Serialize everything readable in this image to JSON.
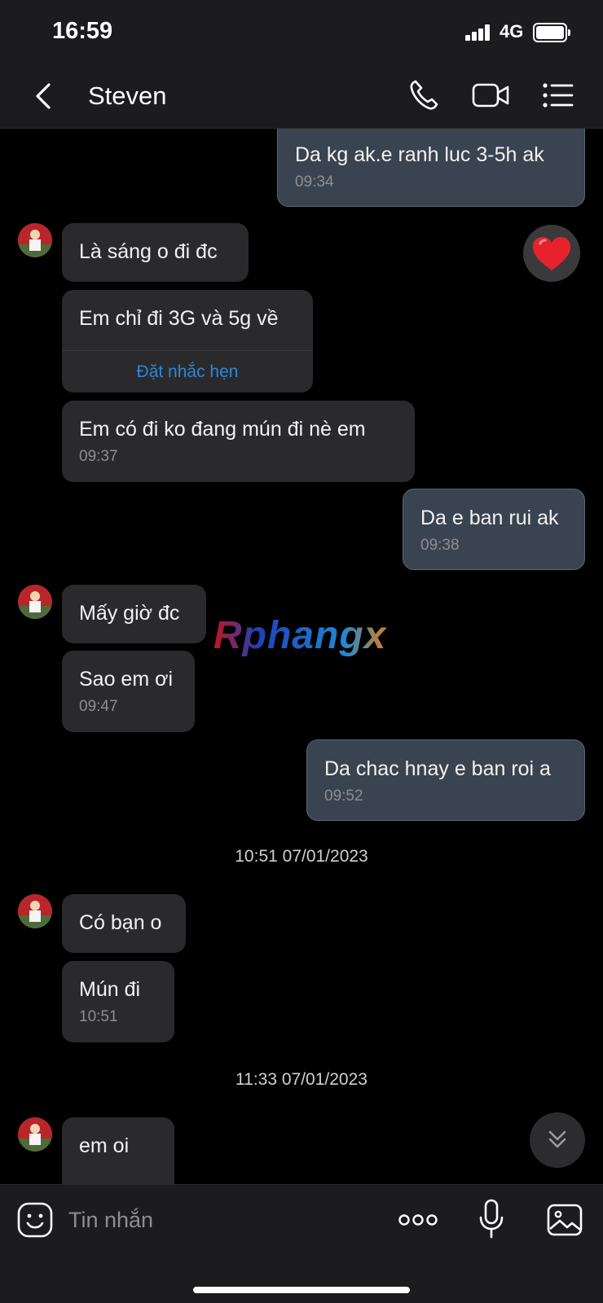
{
  "status_bar": {
    "time": "16:59",
    "network": "4G",
    "signal_icon": "signal-icon",
    "battery_icon": "battery-icon"
  },
  "header": {
    "back_icon": "chevron-left-icon",
    "title": "Steven",
    "call_icon": "phone-icon",
    "video_icon": "video-camera-icon",
    "menu_icon": "list-icon"
  },
  "messages": [
    {
      "id": "m1",
      "direction": "outgoing",
      "text": "Da kg ak.e ranh luc 3-5h ak",
      "time": "09:34"
    },
    {
      "id": "m2",
      "direction": "incoming",
      "text": "Là sáng o đi đc",
      "time": "",
      "reaction": "heart"
    },
    {
      "id": "m3",
      "direction": "incoming",
      "text": "Em chỉ đi 3G và 5g về",
      "time": "",
      "action": "Đặt nhắc hẹn"
    },
    {
      "id": "m4",
      "direction": "incoming",
      "text": "Em có đi ko đang mún đi nè em",
      "time": "09:37"
    },
    {
      "id": "m5",
      "direction": "outgoing",
      "text": "Da e ban rui ak",
      "time": "09:38"
    },
    {
      "id": "m6",
      "direction": "incoming",
      "text": "Mấy giờ đc",
      "time": ""
    },
    {
      "id": "m7",
      "direction": "incoming",
      "text": "Sao em ơi",
      "time": "09:47"
    },
    {
      "id": "m8",
      "direction": "outgoing",
      "text": "Da chac hnay e ban roi a",
      "time": "09:52"
    },
    {
      "id": "m9",
      "direction": "incoming",
      "text": "Có bạn o",
      "time": ""
    },
    {
      "id": "m10",
      "direction": "incoming",
      "text": "Mún đi",
      "time": "10:51"
    },
    {
      "id": "m11",
      "direction": "incoming",
      "text": "em oi",
      "time": ""
    }
  ],
  "dividers": [
    "10:51 07/01/2023",
    "11:33 07/01/2023"
  ],
  "reaction_icon": "heart-icon",
  "scroll_down_icon": "double-chevron-down-icon",
  "watermark": "Rphangx",
  "composer": {
    "emoji_icon": "sticker-smile-icon",
    "placeholder": "Tin nhắn",
    "more_icon": "more-dots-icon",
    "mic_icon": "microphone-icon",
    "image_icon": "image-icon"
  },
  "colors": {
    "incoming_bubble": "#2a2a2c",
    "outgoing_bubble": "#3a4350",
    "link": "#2f87d8",
    "heart": "#e8222d"
  }
}
